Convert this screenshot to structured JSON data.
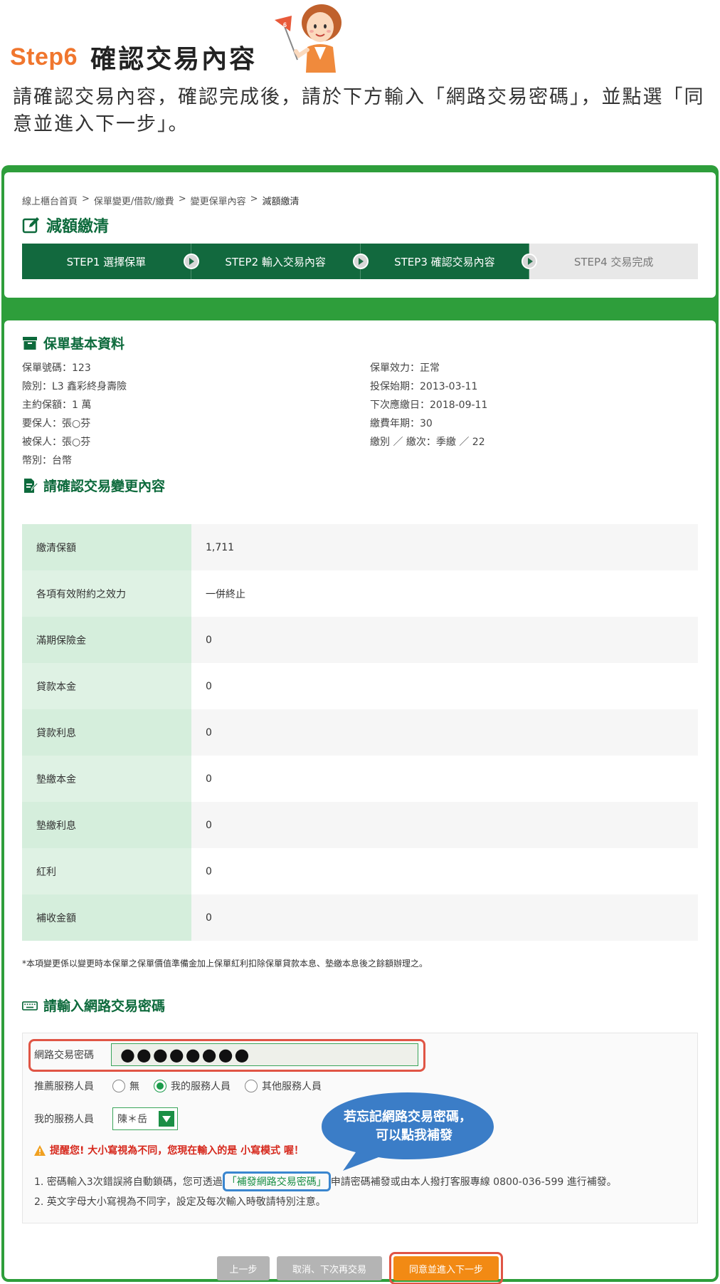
{
  "header": {
    "step_no": "Step6",
    "step_title": "確認交易內容",
    "flag_number": "6",
    "intro": "請確認交易內容，確認完成後，請於下方輸入「網路交易密碼」，並點選「同意並進入下一步」。"
  },
  "breadcrumb": [
    "線上櫃台首頁",
    "保單變更/借款/繳費",
    "變更保單內容",
    "減額繳清"
  ],
  "breadcrumb_sep": ">",
  "page_title": "減額繳清",
  "steps": [
    {
      "label": "STEP1 選擇保單",
      "active": true
    },
    {
      "label": "STEP2 輸入交易內容",
      "active": true
    },
    {
      "label": "STEP3 確認交易內容",
      "active": true
    },
    {
      "label": "STEP4 交易完成",
      "active": false
    }
  ],
  "basic": {
    "title": "保單基本資料",
    "left": [
      "保單號碼：123",
      "險別：L3 鑫彩終身壽險",
      "主約保額：1 萬",
      "要保人：張○芬",
      "被保人：張○芬",
      "幣別：台幣"
    ],
    "right": [
      "保單效力：正常",
      "投保始期：2013-03-11",
      "下次應繳日：2018-09-11",
      "繳費年期：30",
      "繳別 ／ 繳次：季繳 ／ 22"
    ]
  },
  "change": {
    "title": "請確認交易變更內容",
    "rows": [
      {
        "k": "繳清保額",
        "v": "1,711"
      },
      {
        "k": "各項有效附約之效力",
        "v": "一併終止"
      },
      {
        "k": "滿期保險金",
        "v": "0"
      },
      {
        "k": "貸款本金",
        "v": "0"
      },
      {
        "k": "貸款利息",
        "v": "0"
      },
      {
        "k": "墊繳本金",
        "v": "0"
      },
      {
        "k": "墊繳利息",
        "v": "0"
      },
      {
        "k": "紅利",
        "v": "0"
      },
      {
        "k": "補收金額",
        "v": "0"
      }
    ],
    "note": "*本項變更係以變更時本保單之保單價值準備金加上保單紅利扣除保單貸款本息、墊繳本息後之餘額辦理之。"
  },
  "password": {
    "title": "請輸入網路交易密碼",
    "label": "網路交易密碼",
    "value": "●●●●●●●●",
    "agent_label": "推薦服務人員",
    "radio_options": [
      "無",
      "我的服務人員",
      "其他服務人員"
    ],
    "radio_selected": 1,
    "my_agent_label": "我的服務人員",
    "my_agent_value": "陳＊岳",
    "warning": "提醒您! 大小寫視為不同，您現在輸入的是 小寫模式 喔！",
    "hint1_pre": "1. 密碼輸入3次錯誤將自動鎖碼，您可透過",
    "hint1_link": "「補發網路交易密碼」",
    "hint1_post": "申請密碼補發或由本人撥打客服專線 0800-036-599 進行補發。",
    "hint2": "2. 英文字母大小寫視為不同字，設定及每次輸入時敬請特別注意。",
    "bubble_line1": "若忘記網路交易密碼，",
    "bubble_line2": "可以點我補發"
  },
  "buttons": {
    "prev": "上一步",
    "cancel": "取消、下次再交易",
    "next": "同意並進入下一步"
  },
  "colors": {
    "brand_green": "#12693e",
    "frame_green": "#2e9e3b",
    "accent_orange": "#f28a14",
    "warning_red": "#d6281c",
    "bubble_blue": "#3b7dc7"
  }
}
